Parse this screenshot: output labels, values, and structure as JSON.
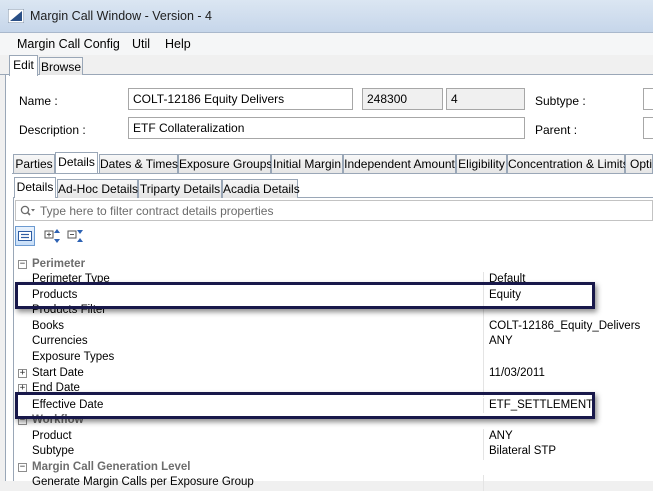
{
  "window": {
    "title": "Margin Call Window - Version - 4"
  },
  "menu": [
    "Margin Call Config",
    "Util",
    "Help"
  ],
  "top_tabs": [
    "Edit",
    "Browse"
  ],
  "form": {
    "name_label": "Name :",
    "name_value": "COLT-12186 Equity Delivers",
    "id_value": "248300",
    "version_value": "4",
    "subtype_label": "Subtype :",
    "description_label": "Description :",
    "description_value": "ETF Collateralization",
    "parent_label": "Parent :"
  },
  "main_tabs": [
    "Parties",
    "Details",
    "Dates & Times",
    "Exposure Groups",
    "Initial Margin",
    "Independent Amount",
    "Eligibility",
    "Concentration & Limits",
    "Opti"
  ],
  "sub_tabs": [
    "Details",
    "Ad-Hoc Details",
    "Triparty Details",
    "Acadia Details"
  ],
  "filter": {
    "placeholder": "Type here to filter contract details properties"
  },
  "grid": {
    "rows": [
      {
        "name": "Perimeter",
        "value": ""
      },
      {
        "name": "Perimeter Type",
        "value": "Default"
      },
      {
        "name": "Products",
        "value": "Equity"
      },
      {
        "name": "Products Filter",
        "value": ""
      },
      {
        "name": "Books",
        "value": "COLT-12186_Equity_Delivers"
      },
      {
        "name": "Currencies",
        "value": "ANY"
      },
      {
        "name": "Exposure Types",
        "value": ""
      },
      {
        "name": "Start Date",
        "value": "11/03/2011"
      },
      {
        "name": "End Date",
        "value": ""
      },
      {
        "name": "Effective Date",
        "value": "ETF_SETTLEMENT"
      },
      {
        "name": "Workflow",
        "value": ""
      },
      {
        "name": "Product",
        "value": "ANY"
      },
      {
        "name": "Subtype",
        "value": "Bilateral STP"
      },
      {
        "name": "Margin Call Generation Level",
        "value": ""
      },
      {
        "name": "Generate Margin Calls per Exposure Group",
        "value": ""
      }
    ]
  },
  "icons": {
    "app": "margin-call-app-icon",
    "search": "search-icon",
    "categorized_view": "categorized-view-icon",
    "expand_all": "expand-all-icon",
    "collapse_all": "collapse-all-icon"
  },
  "colors": {
    "highlight": "#18184a",
    "category_text": "#6d6d6d"
  }
}
